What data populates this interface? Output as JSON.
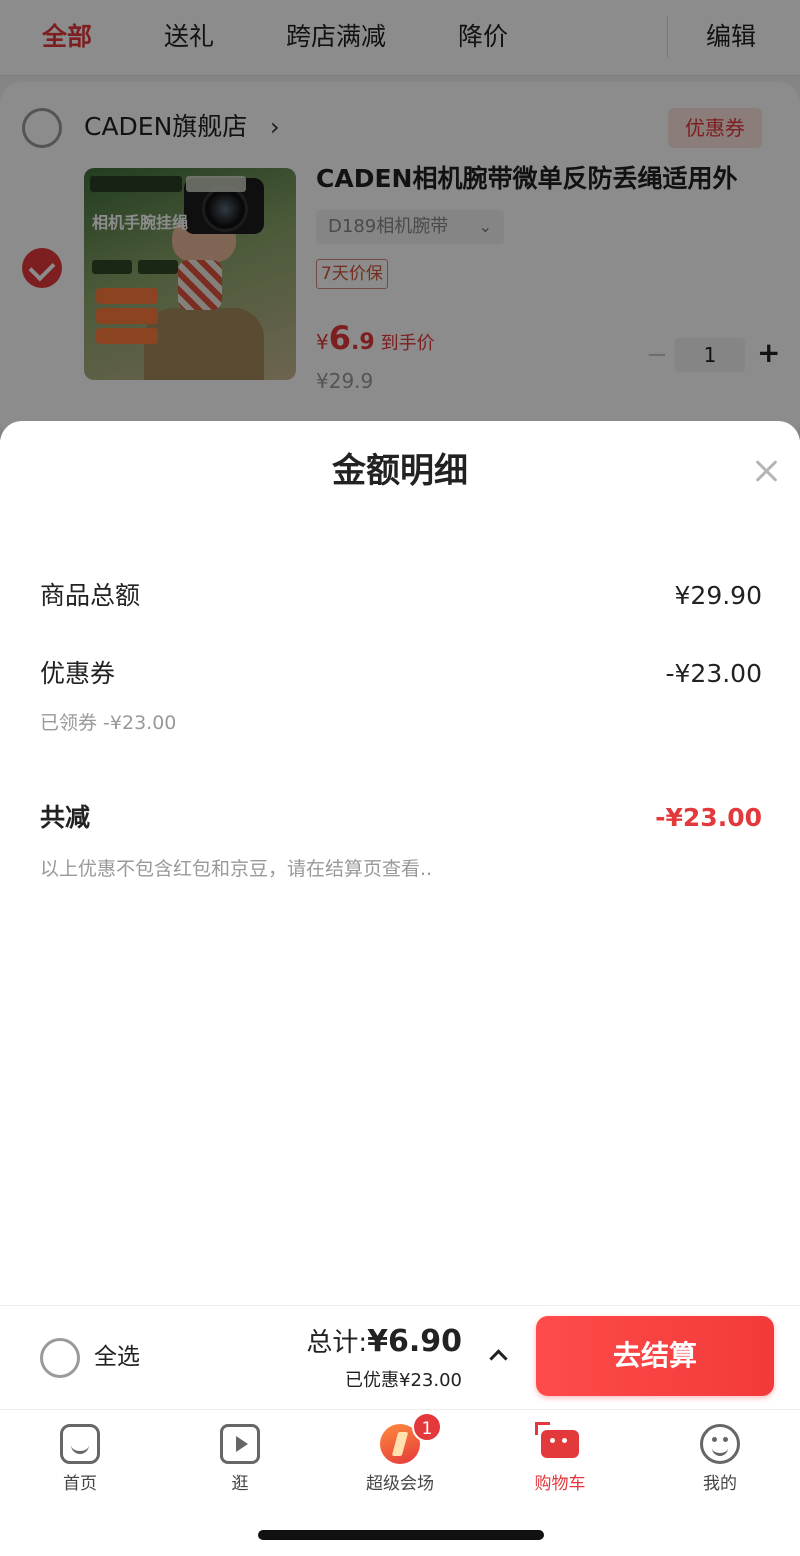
{
  "filter_tabs": [
    {
      "label": "全部",
      "active": true
    },
    {
      "label": "送礼",
      "active": false
    },
    {
      "label": "跨店满减",
      "active": false
    },
    {
      "label": "降价",
      "active": false
    }
  ],
  "edit_label": "编辑",
  "store": {
    "name": "CADEN旗舰店",
    "chevron": "›",
    "coupon_badge": "优惠券"
  },
  "product": {
    "image_title": "相机手腕挂绳",
    "title": "CADEN相机腕带微单反防丢绳适用外",
    "variant": "D189相机腕带",
    "variant_chevron": "⌄",
    "price_guard": "7天价保",
    "price_symbol": "¥",
    "price_int": "6",
    "price_dec": ".9",
    "price_suffix": "到手价",
    "original_price": "¥29.9",
    "quantity_minus": "−",
    "quantity": "1",
    "quantity_plus": "+"
  },
  "sheet": {
    "title": "金额明细",
    "rows": [
      {
        "label": "商品总额",
        "value": "¥29.90"
      },
      {
        "label": "优惠券",
        "value": "-¥23.00",
        "sub": "已领券 -¥23.00"
      },
      {
        "label": "共减",
        "value": "-¥23.00",
        "sub": "以上优惠不包含红包和京豆，请在结算页查看.."
      }
    ]
  },
  "checkout": {
    "select_all": "全选",
    "total_label": "总计:",
    "total_amount": "¥6.90",
    "saved": "已优惠¥23.00",
    "button": "去结算"
  },
  "tabbar": [
    {
      "label": "首页",
      "icon": "home-icon"
    },
    {
      "label": "逛",
      "icon": "stroll-icon"
    },
    {
      "label": "超级会场",
      "icon": "mega-sale-icon",
      "badge": "1"
    },
    {
      "label": "购物车",
      "icon": "cart-icon",
      "active": true
    },
    {
      "label": "我的",
      "icon": "profile-icon"
    }
  ],
  "colors": {
    "accent": "#e4393c",
    "overlay": "rgba(0,0,0,0.45)"
  }
}
